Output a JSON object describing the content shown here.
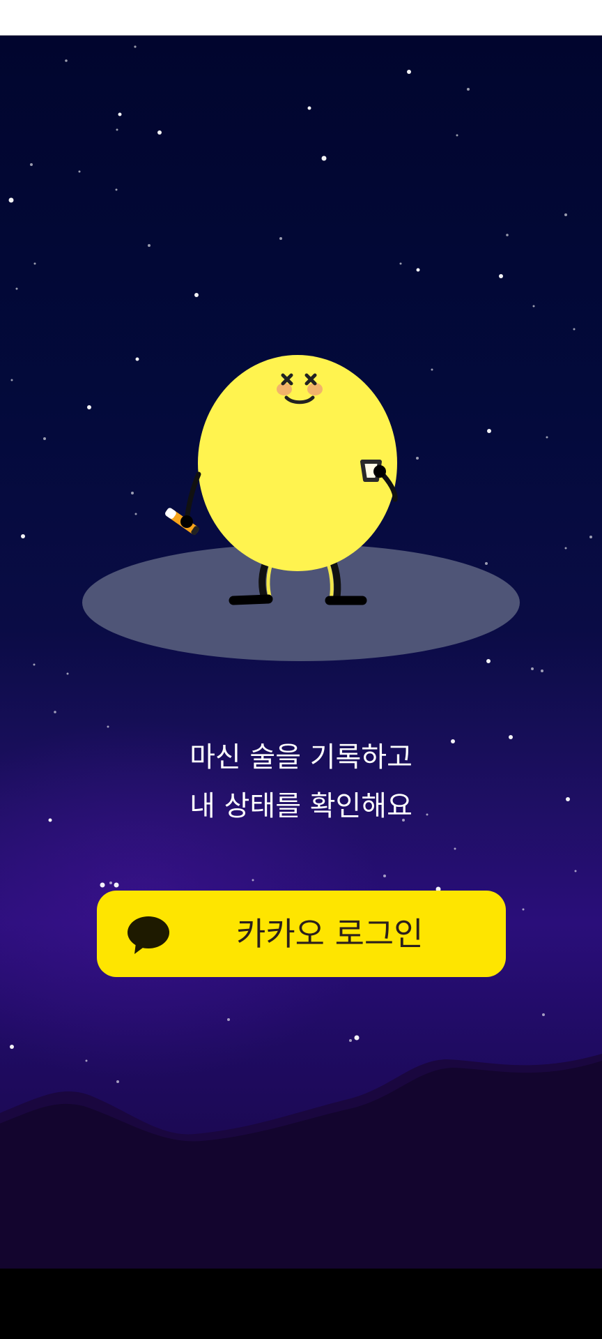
{
  "tagline": {
    "line1": "마신 술을 기록하고",
    "line2": "내 상태를 확인해요"
  },
  "login": {
    "label": "카카오 로그인",
    "background": "#fee500",
    "text_color": "#2b1f1c",
    "icon": "kakao-speech-bubble-icon"
  },
  "character": {
    "body_color": "#fff34f",
    "platform_color": "#4f5577",
    "left_hand_item": "pen-icon",
    "right_hand_item": "glass-icon"
  },
  "colors": {
    "sky_top": "#01052e",
    "sky_bottom": "#2a0e7a",
    "mountain": "#14062e"
  }
}
